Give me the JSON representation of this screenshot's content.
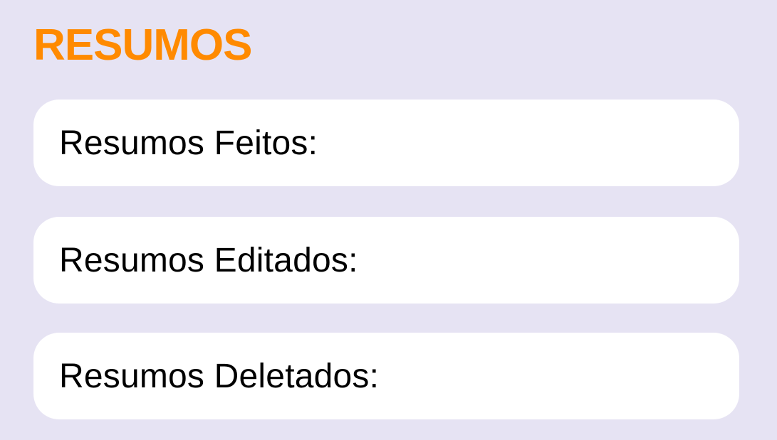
{
  "header": {
    "title": "RESUMOS"
  },
  "stats": [
    {
      "label": "Resumos Feitos:",
      "value": ""
    },
    {
      "label": "Resumos Editados:",
      "value": ""
    },
    {
      "label": "Resumos Deletados:",
      "value": ""
    }
  ],
  "colors": {
    "background": "#e6e3f3",
    "accent": "#ff8a00",
    "card": "#ffffff",
    "text": "#000000"
  }
}
